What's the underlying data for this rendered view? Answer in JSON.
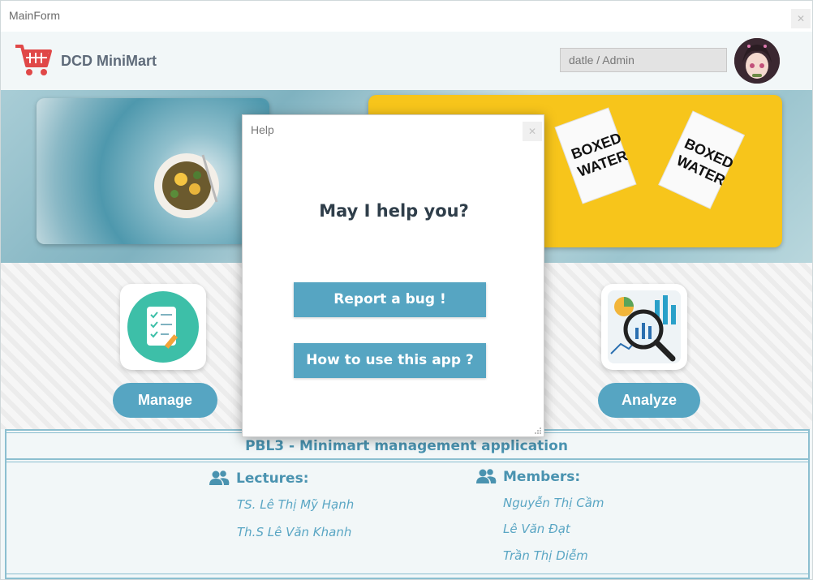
{
  "window": {
    "title": "MainForm",
    "close_glyph": "✕"
  },
  "header": {
    "brand": "DCD MiniMart",
    "cart_icon": "shopping-cart-icon",
    "user_field": "datle / Admin",
    "avatar": "user-avatar"
  },
  "features": {
    "manage_label": "Manage",
    "analyze_label": "Analyze"
  },
  "info": {
    "title": "PBL3 - Minimart management application",
    "lectures_heading": "Lectures:",
    "lectures": [
      "TS. Lê Thị Mỹ Hạnh",
      "Th.S Lê Văn Khanh"
    ],
    "members_heading": "Members:",
    "members": [
      "Nguyễn Thị Cầm",
      "Lê Văn Đạt",
      "Trần Thị Diễm"
    ]
  },
  "dialog": {
    "title": "Help",
    "close_glyph": "✕",
    "heading": "May I help you?",
    "report_bug_label": "Report a bug !",
    "how_to_label": "How to use this app ?"
  },
  "colors": {
    "accent": "#56a5c2",
    "info_text": "#4a93b0",
    "banner_yellow": "#f7c51b",
    "cart_red": "#e04848"
  }
}
